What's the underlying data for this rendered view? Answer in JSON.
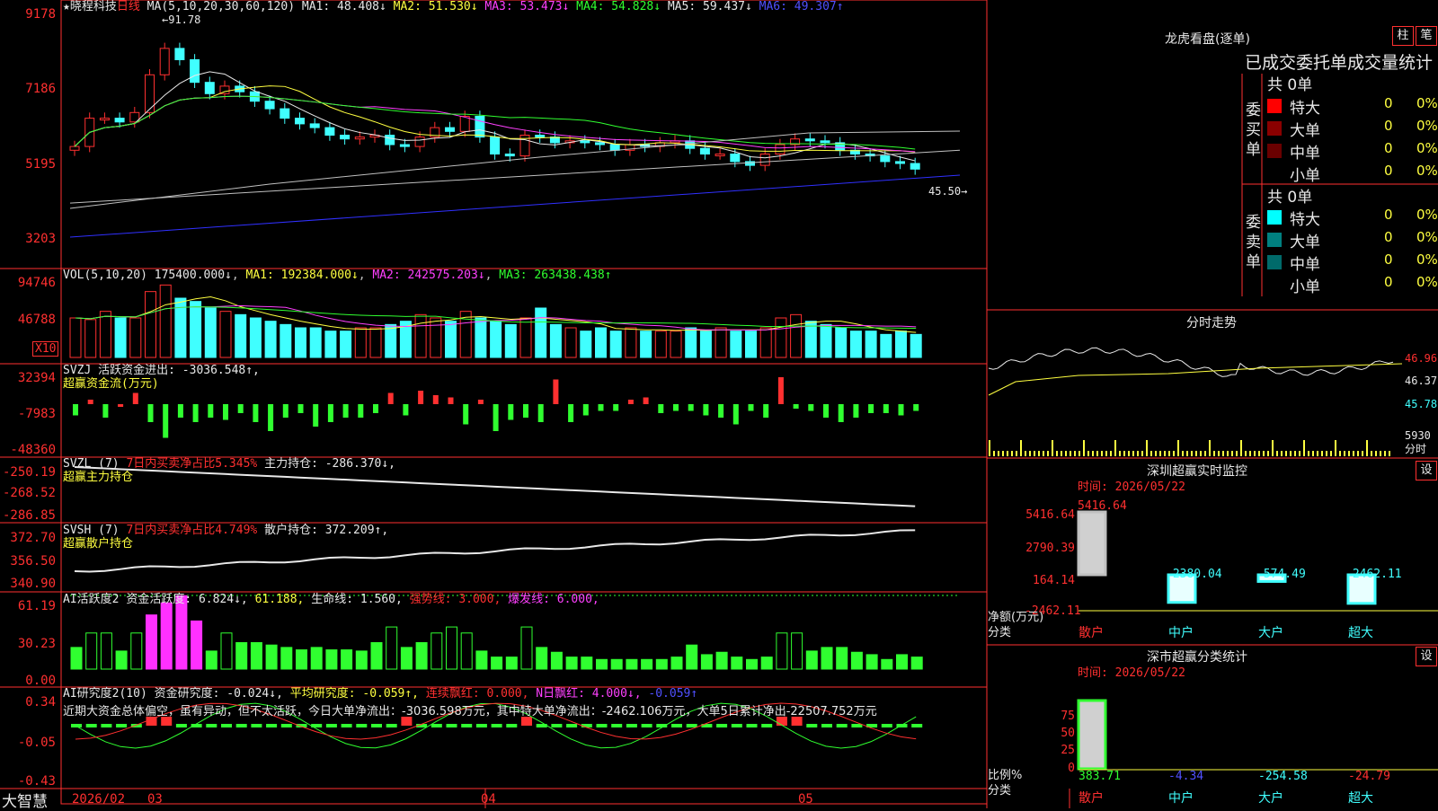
{
  "stock": {
    "name": "★晓程科技",
    "period": "日线",
    "ma_header": "MA(5,10,20,30,60,120)",
    "ma1": "MA1: 48.408↓",
    "ma2": "MA2: 51.530↓",
    "ma3": "MA3: 53.473↓",
    "ma4": "MA4: 54.828↓",
    "ma5": "MA5: 59.437↓",
    "ma6": "MA6: 49.307↑",
    "high_mark": "91.78",
    "last_mark": "45.50→"
  },
  "price_axis": [
    "9178",
    "7186",
    "5195",
    "3203"
  ],
  "vol": {
    "header": "VOL(5,10,20)",
    "v": "175400.000↓",
    "ma1": "MA1: 192384.000↓",
    "ma2": "MA2: 242575.203↓",
    "ma3": "MA3: 263438.438↑",
    "axis": [
      "94746",
      "46788"
    ],
    "unit": "X10"
  },
  "svzj": {
    "header": "SVZJ",
    "active": "活跃资金进出: -3036.548↑,",
    "sub": "超赢资金流(万元)",
    "axis": [
      "32394",
      "-7983",
      "-48360"
    ]
  },
  "svzl": {
    "header": "SVZL (7)",
    "ratio": "7日内买卖净占比5.345%",
    "hold": "主力持仓: -286.370↓,",
    "sub": "超赢主力持仓",
    "axis": [
      "-250.19",
      "-268.52",
      "-286.85"
    ]
  },
  "svsh": {
    "header": "SVSH (7)",
    "ratio": "7日内买卖净占比4.749%",
    "hold": "散户持仓: 372.209↑,",
    "sub": "超赢散户持仓",
    "axis": [
      "372.70",
      "356.50",
      "340.90"
    ]
  },
  "ai_active": {
    "header": "AI活跃度2",
    "act": "资金活跃度: 6.824↓,",
    "v2": "61.188,",
    "life": "生命线: 1.560,",
    "strong": "强势线: 3.000,",
    "burst": "爆发线: 6.000,",
    "axis": [
      "61.19",
      "30.23",
      "0.00"
    ]
  },
  "ai_research": {
    "header": "AI研究度2(10)",
    "res": "资金研究度: -0.024↓,",
    "avg": "平均研究度: -0.059↑,",
    "cont": "连续飘红: 0.000,",
    "nday": "N日飘红: 4.000↓,",
    "last": "-0.059↑",
    "summary": "近期大资金总体偏空，虽有异动，但不太活跃，今日大单净流出：-3036.598万元，其中特大单净流出：-2462.106万元，大单5日累计净出-22507.752万元",
    "axis": [
      "0.34",
      "-0.05",
      "-0.43"
    ]
  },
  "time_axis": [
    "2026/02",
    "03",
    "04",
    "05"
  ],
  "brand": "大智慧",
  "right": {
    "dragon_title": "龙虎看盘(逐单)",
    "tab1": "柱",
    "tab2": "笔",
    "stat_title": "已成交委托单成交量统计",
    "buy": {
      "label": "委买单",
      "total": "共 0单",
      "rows": [
        {
          "name": "特大",
          "val": "0",
          "pct": "0%",
          "color": "#ff0000"
        },
        {
          "name": "大单",
          "val": "0",
          "pct": "0%",
          "color": "#8a0000"
        },
        {
          "name": "中单",
          "val": "0",
          "pct": "0%",
          "color": "#6a0000"
        },
        {
          "name": "小单",
          "val": "0",
          "pct": "0%",
          "color": "#000000"
        }
      ]
    },
    "sell": {
      "label": "委卖单",
      "total": "共 0单",
      "rows": [
        {
          "name": "特大",
          "val": "0",
          "pct": "0%",
          "color": "#00ffff"
        },
        {
          "name": "大单",
          "val": "0",
          "pct": "0%",
          "color": "#008080"
        },
        {
          "name": "中单",
          "val": "0",
          "pct": "0%",
          "color": "#006a6a"
        },
        {
          "name": "小单",
          "val": "0",
          "pct": "0%",
          "color": "#000000"
        }
      ]
    },
    "intraday_title": "分时走势",
    "intraday_axis": [
      "46.96",
      "46.37",
      "45.78"
    ],
    "intraday_vol": "5930",
    "intraday_unit": "分时",
    "sz_monitor_title": "深圳超赢实时监控",
    "set1": "设",
    "sz_time": "时间: 2026/05/22",
    "sz_axis": [
      "5416.64",
      "2790.39",
      "164.14",
      "-2462.11"
    ],
    "sz_top": "5416.64",
    "sz_vals": [
      "-2380.04",
      "-574.49",
      "-2462.11"
    ],
    "sz_unit": "净额(万元)",
    "sz_cat": "分类",
    "cats": [
      "散户",
      "中户",
      "大户",
      "超大"
    ],
    "class_title": "深市超赢分类统计",
    "set2": "设",
    "class_time": "时间: 2026/05/22",
    "class_axis": [
      "75",
      "50",
      "25",
      "0"
    ],
    "class_unit": "比例%",
    "class_cat": "分类",
    "class_vals": [
      "383.71",
      "-4.34",
      "-254.58",
      "-24.79"
    ]
  },
  "chart_data": [
    {
      "type": "candlestick",
      "title": "★晓程科技 日线",
      "ylabel": "",
      "ylim": [
        3203,
        9178
      ],
      "ma_last": {
        "MA1": 48.408,
        "MA2": 51.53,
        "MA3": 53.473,
        "MA4": 54.828,
        "MA5": 59.437,
        "MA6": 49.307
      },
      "high": 91.78,
      "last_close": 45.5,
      "closes": [
        5700,
        6450,
        6450,
        6350,
        6600,
        7600,
        8300,
        8000,
        7400,
        7100,
        7300,
        7150,
        6900,
        6700,
        6450,
        6300,
        6200,
        6000,
        5900,
        5950,
        6000,
        5750,
        5700,
        5950,
        6200,
        6100,
        6500,
        5950,
        5500,
        5450,
        6000,
        5950,
        5800,
        5850,
        5800,
        5750,
        5600,
        5750,
        5700,
        5800,
        5850,
        5650,
        5500,
        5500,
        5300,
        5200,
        5500,
        5750,
        5900,
        5850,
        5800,
        5600,
        5500,
        5450,
        5300,
        5250,
        5100
      ]
    },
    {
      "type": "bar",
      "title": "VOL(5,10,20)",
      "values": [
        12,
        11.5,
        14,
        12,
        12,
        20,
        22,
        18,
        17,
        15,
        14,
        13,
        12,
        11,
        10,
        9,
        9,
        8,
        8,
        9,
        9,
        10,
        11,
        13,
        12,
        11,
        14,
        12,
        11,
        10,
        12,
        15,
        10,
        9,
        8,
        9,
        8,
        9,
        8,
        8,
        8,
        9,
        8,
        9,
        8,
        8,
        9,
        12,
        13,
        11,
        10,
        9,
        8,
        8,
        7,
        8,
        7
      ]
    },
    {
      "type": "bar",
      "title": "超赢资金流(万元)",
      "ylim": [
        -48360,
        32394
      ],
      "values": [
        -5,
        2,
        -6,
        0,
        5,
        -8,
        -15,
        -6,
        -8,
        -6,
        -7,
        -4,
        -8,
        -12,
        -6,
        -4,
        -10,
        -8,
        -6,
        -6,
        -4,
        5,
        -5,
        6,
        4,
        3,
        -9,
        2,
        -12,
        -7,
        -6,
        -8,
        11,
        -8,
        -5,
        -3,
        -3,
        2,
        3,
        -4,
        -3,
        -3,
        -5,
        -6,
        -9,
        -3,
        -6,
        12,
        -2,
        -3,
        -6,
        -8,
        -6,
        -4,
        -4,
        -5,
        -3
      ]
    },
    {
      "type": "line",
      "title": "超赢主力持仓",
      "ylim": [
        -286.85,
        -250.19
      ]
    },
    {
      "type": "line",
      "title": "超赢散户持仓",
      "ylim": [
        340.9,
        372.7
      ]
    },
    {
      "type": "bar",
      "title": "AI活跃度2",
      "ylim": [
        0,
        61.19
      ],
      "values": [
        18,
        30,
        30,
        15,
        30,
        45,
        55,
        61,
        40,
        15,
        30,
        22,
        22,
        20,
        18,
        16,
        18,
        16,
        16,
        15,
        22,
        35,
        18,
        22,
        30,
        35,
        30,
        15,
        10,
        10,
        35,
        18,
        14,
        10,
        10,
        8,
        8,
        8,
        8,
        8,
        10,
        20,
        12,
        14,
        10,
        8,
        10,
        30,
        30,
        15,
        18,
        18,
        14,
        12,
        8,
        12,
        10
      ]
    },
    {
      "type": "bar",
      "title": "AI研究度2(10)",
      "ylim": [
        -0.43,
        0.34
      ]
    },
    {
      "type": "bar",
      "title": "深圳超赢实时监控",
      "categories": [
        "散户",
        "中户",
        "大户",
        "超大"
      ],
      "values": [
        5416.64,
        -2380.04,
        -574.49,
        -2462.11
      ],
      "ylim": [
        -2462.11,
        5416.64
      ]
    },
    {
      "type": "bar",
      "title": "深市超赢分类统计",
      "categories": [
        "散户",
        "中户",
        "大户",
        "超大"
      ],
      "values": [
        383.71,
        -4.34,
        -254.58,
        -24.79
      ]
    }
  ]
}
